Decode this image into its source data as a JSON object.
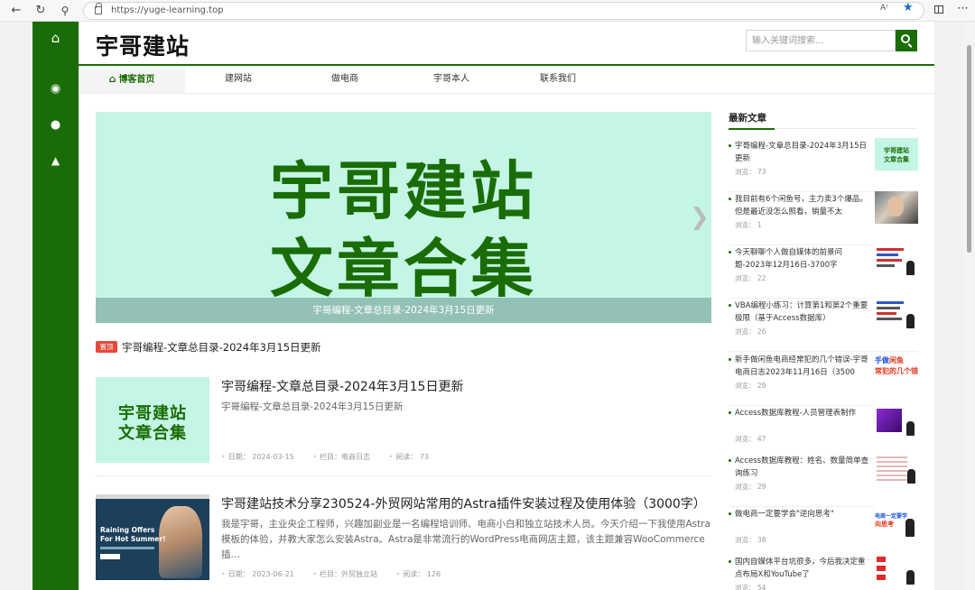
{
  "browser": {
    "url": "https://yuge-learning.top",
    "read_aloud": "A⁾"
  },
  "site": {
    "logo": "宇哥建站",
    "search_placeholder": "输入关键词搜索..."
  },
  "nav": {
    "items": [
      {
        "label": "博客首页",
        "active": true
      },
      {
        "label": "建网站"
      },
      {
        "label": "做电商"
      },
      {
        "label": "宇哥本人"
      },
      {
        "label": "联系我们"
      }
    ]
  },
  "banner": {
    "line1": "宇哥建站",
    "line2": "文章合集",
    "caption": "宇哥编程-文章总目录-2024年3月15日更新"
  },
  "sticky": {
    "badge": "置顶",
    "title": "宇哥编程-文章总目录-2024年3月15日更新"
  },
  "articles": [
    {
      "title": "宇哥编程-文章总目录-2024年3月15日更新",
      "desc": "宇哥编程-文章总目录-2024年3月15日更新",
      "thumb_line1": "宇哥建站",
      "thumb_line2": "文章合集",
      "date": "日期：  2024-03-15",
      "category": "栏目：电商日志",
      "views": "阅读：  73"
    },
    {
      "title": "宇哥建站技术分享230524-外贸网站常用的Astra插件安装过程及使用体验（3000字）",
      "desc": "我是宇哥，主业央企工程师，兴趣加副业是一名编程培训师、电商小白和独立站技术人员。今天介绍一下我使用Astra模板的体验，并教大家怎么安装Astra。Astra是非常流行的WordPress电商网店主题，该主题兼容WooCommerce插…",
      "thumb_line1": "Raining Offers",
      "thumb_line2": "For Hot Summer!",
      "date": "日期：  2023-06-21",
      "category": "栏目：外贸独立站",
      "views": "阅读：  126"
    }
  ],
  "sidebar": {
    "heading": "最新文章",
    "items": [
      {
        "title": "宇哥编程-文章总目录-2024年3月15日更新",
        "views": "浏览：  73",
        "thumb": "mint",
        "thumb_text1": "宇哥建站",
        "thumb_text2": "文章合集"
      },
      {
        "title": "我目前有6个闲鱼号，主力卖3个爆品。但是最近没怎么照看，销量不太",
        "views": "浏览：  1",
        "thumb": "photo"
      },
      {
        "title": "今天聊聊个人做自媒体的前景问题-2023年12月16日-3700字",
        "views": "浏览：  22",
        "thumb": "slide"
      },
      {
        "title": "VBA编程小练习：计算第1和第2个重要极限（基于Access数据库）",
        "views": "浏览：  26",
        "thumb": "slide"
      },
      {
        "title": "新手做闲鱼电商经常犯的几个错误-宇哥电商日志2023年11月16日（3500",
        "views": "浏览：  29",
        "thumb": "red",
        "thumb_text1": "手做",
        "thumb_text1b": "闲鱼",
        "thumb_text2": "常犯的几个错"
      },
      {
        "title": "Access数据库教程-人员管理表制作",
        "views": "浏览：  47",
        "thumb": "purple"
      },
      {
        "title": "Access数据库教程：姓名、数量简单查询练习",
        "views": "浏览：  29",
        "thumb": "table"
      },
      {
        "title": "做电商一定要学会\"逆向思考\"",
        "views": "浏览：  38",
        "thumb": "ecom",
        "thumb_text1": "电商一定要学",
        "thumb_text2": "向思考"
      },
      {
        "title": "国内自媒体平台坑很多，今后我决定重点布局X和YouTube了",
        "views": "浏览：  54",
        "thumb": "yt"
      }
    ]
  },
  "colors": {
    "brand_green": "#1a6d06",
    "mint": "#c4f6e6",
    "badge_red": "#e5483c"
  }
}
